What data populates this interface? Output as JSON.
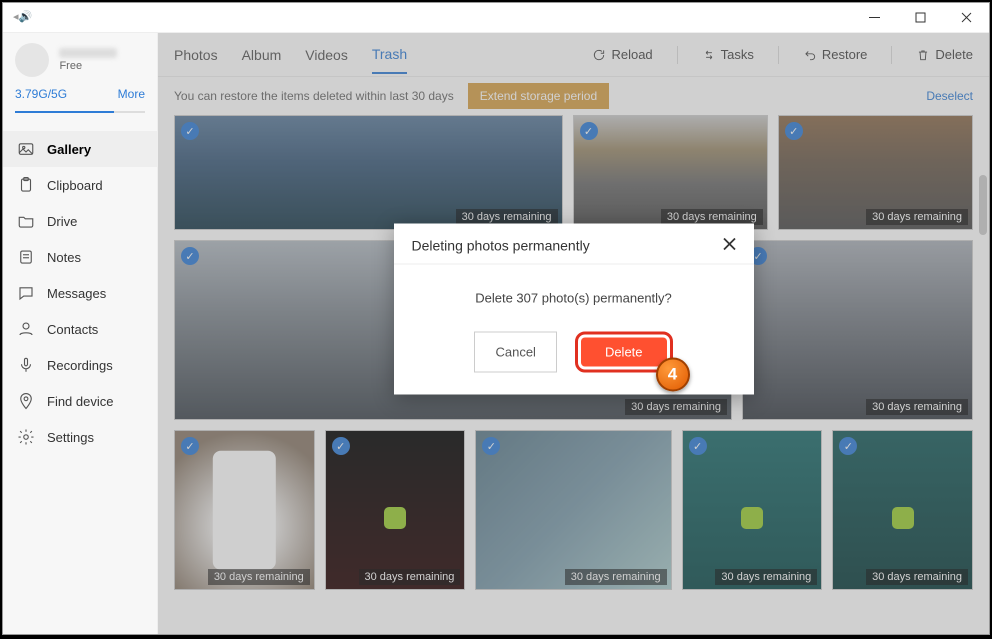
{
  "user": {
    "plan": "Free"
  },
  "storage": {
    "usage": "3.79G/5G",
    "more": "More"
  },
  "sidebar": {
    "items": [
      {
        "label": "Gallery"
      },
      {
        "label": "Clipboard"
      },
      {
        "label": "Drive"
      },
      {
        "label": "Notes"
      },
      {
        "label": "Messages"
      },
      {
        "label": "Contacts"
      },
      {
        "label": "Recordings"
      },
      {
        "label": "Find device"
      }
    ],
    "settings": "Settings"
  },
  "tabs": {
    "photos": "Photos",
    "album": "Album",
    "videos": "Videos",
    "trash": "Trash"
  },
  "actions": {
    "reload": "Reload",
    "tasks": "Tasks",
    "restore": "Restore",
    "delete": "Delete"
  },
  "infobar": {
    "msg": "You can restore the items deleted within last 30 days",
    "extend": "Extend storage period",
    "deselect": "Deselect"
  },
  "thumb": {
    "remain": "30 days remaining"
  },
  "modal": {
    "title": "Deleting photos permanently",
    "body": "Delete 307 photo(s) permanently?",
    "cancel": "Cancel",
    "delete": "Delete",
    "step": "4"
  }
}
